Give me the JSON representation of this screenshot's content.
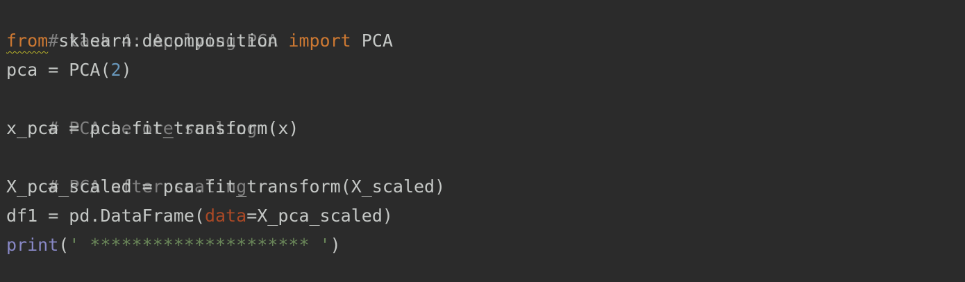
{
  "editor": {
    "theme_colors": {
      "background": "#2b2b2b",
      "default_text": "#c5c8c6",
      "comment": "#808080",
      "keyword": "#cc7832",
      "number": "#6897bb",
      "named_parameter": "#aa4926",
      "builtin": "#8888c6",
      "string": "#6a8759",
      "warning_underline": "#bbb529"
    },
    "lines": [
      {
        "comment": "# task 4: Applying PCA"
      },
      {
        "kw_from": "from",
        "module": " sklearn.decomposition ",
        "kw_import": "import",
        "name": " PCA"
      },
      {
        "pre": "pca = PCA(",
        "number": "2",
        "post": ")"
      },
      {
        "comment": "# PCA before scaling"
      },
      {
        "text": "x_pca = pca.fit_transform(x)"
      },
      {
        "comment": "# PCA after scaling"
      },
      {
        "text": "X_pca_scaled = pca.fit_transform(X_scaled)"
      },
      {
        "pre": "df1 = pd.DataFrame(",
        "param": "data",
        "post": "=X_pca_scaled)"
      },
      {
        "builtin": "print",
        "open": "(",
        "string": "' ********************* '",
        "close": ")"
      }
    ]
  }
}
